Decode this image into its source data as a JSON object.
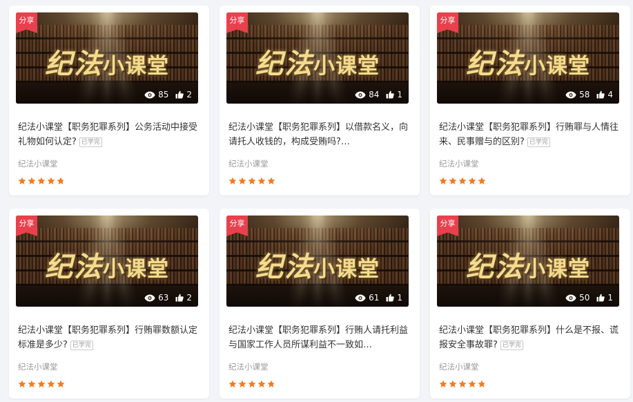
{
  "colors": {
    "accent_red": "#e8414d",
    "star_orange": "#f57a1f",
    "title_gold": "#f4dc8e"
  },
  "thumbnail_title": {
    "part1": "纪法",
    "part2": "小课堂"
  },
  "badge_label": "分享",
  "learned_tag": "已学完",
  "cards": [
    {
      "title": "纪法小课堂【职务犯罪系列】公务活动中接受礼物如何认定?",
      "show_learned": true,
      "source": "纪法小课堂",
      "views": "85",
      "likes": "2",
      "rating": 4.5
    },
    {
      "title": "纪法小课堂【职务犯罪系列】以借款名义，向请托人收钱的，构成受贿吗?…",
      "show_learned": false,
      "source": "纪法小课堂",
      "views": "84",
      "likes": "1",
      "rating": 5
    },
    {
      "title": "纪法小课堂【职务犯罪系列】行贿罪与人情往来、民事赠与的区别?",
      "show_learned": true,
      "source": "纪法小课堂",
      "views": "58",
      "likes": "4",
      "rating": 5
    },
    {
      "title": "纪法小课堂【职务犯罪系列】行贿罪数额认定标准是多少?",
      "show_learned": true,
      "source": "纪法小课堂",
      "views": "63",
      "likes": "2",
      "rating": 5
    },
    {
      "title": "纪法小课堂【职务犯罪系列】行贿人请托利益与国家工作人员所谋利益不一致如…",
      "show_learned": false,
      "source": "纪法小课堂",
      "views": "61",
      "likes": "1",
      "rating": 4.5
    },
    {
      "title": "纪法小课堂【职务犯罪系列】什么是不报、谎报安全事故罪?",
      "show_learned": true,
      "source": "纪法小课堂",
      "views": "50",
      "likes": "1",
      "rating": 4.5
    }
  ]
}
